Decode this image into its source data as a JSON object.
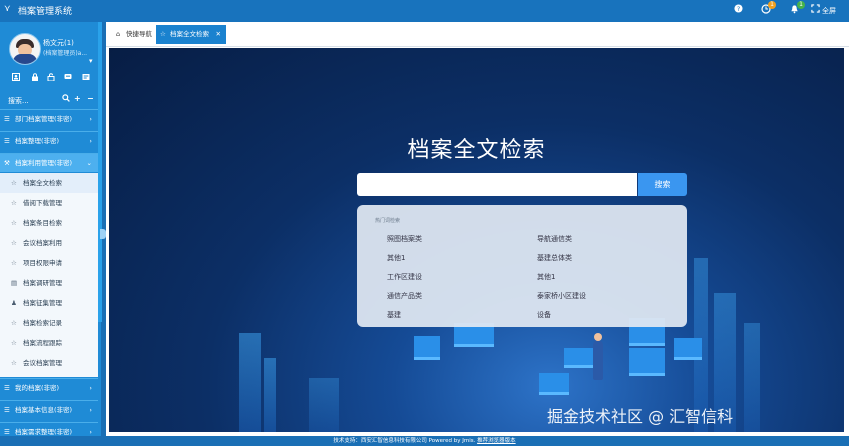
{
  "app": {
    "title": "档案管理系统"
  },
  "topbar": {
    "badge1": "1",
    "badge2": "1",
    "fullscreen_label": "全屏"
  },
  "user": {
    "name": "杨文元(1)",
    "role": "(档案管理员)a..."
  },
  "sidebar": {
    "search_placeholder": "搜索...",
    "menus": [
      {
        "label": "部门档案管理(非密)"
      },
      {
        "label": "档案整理(非密)"
      },
      {
        "label": "档案利用管理(非密)"
      }
    ],
    "subitems": [
      {
        "label": "档案全文检索"
      },
      {
        "label": "借阅下载管理"
      },
      {
        "label": "档案条目检索"
      },
      {
        "label": "会议档案利用"
      },
      {
        "label": "项目权限申请"
      },
      {
        "label": "档案调研管理"
      },
      {
        "label": "档案征集管理"
      },
      {
        "label": "档案检索记录"
      },
      {
        "label": "档案流程跟踪"
      },
      {
        "label": "会议档案管理"
      }
    ],
    "bottom_menus": [
      {
        "label": "我的档案(非密)"
      },
      {
        "label": "档案基本信息(非密)"
      },
      {
        "label": "档案需求整理(非密)"
      }
    ]
  },
  "tabs": [
    {
      "label": "快捷导航"
    },
    {
      "label": "档案全文检索"
    }
  ],
  "search": {
    "title": "档案全文检索",
    "placeholder": "",
    "button": "搜索"
  },
  "hot": {
    "title": "热门词检索",
    "items": [
      "照图档案类",
      "导航通信类",
      "其他1",
      "基建总体类",
      "工作区建设",
      "其他1",
      "通信产品类",
      "泰家桥小区建设",
      "基建",
      "设备"
    ]
  },
  "watermark": "掘金技术社区 @ 汇智信科",
  "footer": {
    "text": "技术支持：西安汇智信息科技有限公司 Powered by Jmis.",
    "link": "推荐浏览器版本"
  },
  "colors": {
    "topbar": "#1873bd",
    "sidebar": "#1f8bd6",
    "accent": "#3a96f0"
  }
}
